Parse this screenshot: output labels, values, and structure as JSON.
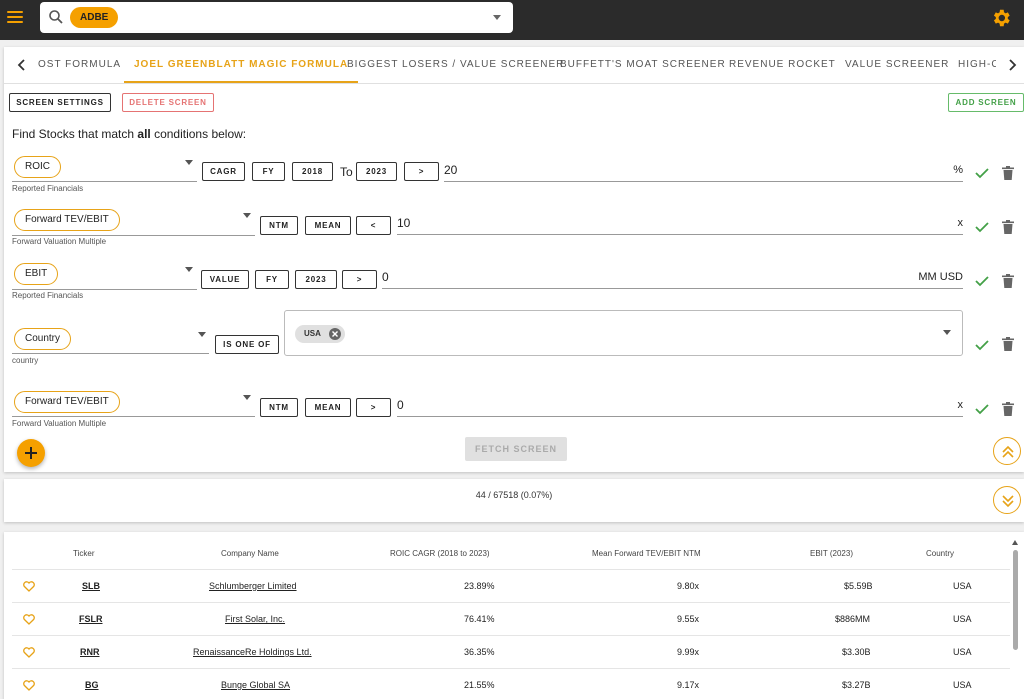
{
  "search": {
    "ticker": "ADBE"
  },
  "tabs": [
    {
      "label": "OST FORMULA"
    },
    {
      "label": "JOEL GREENBLATT MAGIC FORMULA"
    },
    {
      "label": "BIGGEST LOSERS / VALUE SCREENER"
    },
    {
      "label": "BUFFETT'S MOAT SCREENER"
    },
    {
      "label": "REVENUE ROCKET"
    },
    {
      "label": "VALUE SCREENER"
    },
    {
      "label": "HIGH-C"
    }
  ],
  "toolbar": {
    "screen_settings": "SCREEN SETTINGS",
    "delete_screen": "DELETE SCREEN",
    "add_screen": "ADD SCREEN"
  },
  "intro": {
    "prefix": "Find Stocks that match ",
    "emph": "all",
    "suffix": " conditions below:"
  },
  "conditions": [
    {
      "metric": "ROIC",
      "source": "Reported Financials",
      "pills": [
        "CAGR",
        "FY",
        "2018"
      ],
      "to": "To",
      "pills2": [
        "2023"
      ],
      "operator": ">",
      "value": "20",
      "unit": "%"
    },
    {
      "metric": "Forward TEV/EBIT",
      "source": "Forward Valuation Multiple",
      "pills": [
        "NTM",
        "MEAN"
      ],
      "operator": "<",
      "value": "10",
      "unit": "x"
    },
    {
      "metric": "EBIT",
      "source": "Reported Financials",
      "pills": [
        "VALUE",
        "FY",
        "2023"
      ],
      "operator": ">",
      "value": "0",
      "unit": "MM USD"
    },
    {
      "metric": "Country",
      "source": "country",
      "pills": [
        "IS ONE OF"
      ],
      "chips": [
        "USA"
      ]
    },
    {
      "metric": "Forward TEV/EBIT",
      "source": "Forward Valuation Multiple",
      "pills": [
        "NTM",
        "MEAN"
      ],
      "operator": ">",
      "value": "0",
      "unit": "x"
    }
  ],
  "fetch": {
    "label": "FETCH SCREEN"
  },
  "result_count": "44 / 67518 (0.07%)",
  "table": {
    "headers": [
      "Ticker",
      "Company Name",
      "ROIC CAGR (2018 to 2023)",
      "Mean Forward TEV/EBIT NTM",
      "EBIT (2023)",
      "Country"
    ],
    "rows": [
      {
        "ticker": "SLB",
        "company": "Schlumberger Limited",
        "roic": "23.89%",
        "tev": "9.80x",
        "ebit": "$5.59B",
        "country": "USA"
      },
      {
        "ticker": "FSLR",
        "company": "First Solar, Inc.",
        "roic": "76.41%",
        "tev": "9.55x",
        "ebit": "$886MM",
        "country": "USA"
      },
      {
        "ticker": "RNR",
        "company": "RenaissanceRe Holdings Ltd.",
        "roic": "36.35%",
        "tev": "9.99x",
        "ebit": "$3.30B",
        "country": "USA"
      },
      {
        "ticker": "BG",
        "company": "Bunge Global SA",
        "roic": "21.55%",
        "tev": "9.17x",
        "ebit": "$3.27B",
        "country": "USA"
      }
    ]
  },
  "colors": {
    "accent": "#f5a000",
    "tab_active": "#e7a318",
    "check": "#43a047",
    "delete": "#e57373"
  }
}
